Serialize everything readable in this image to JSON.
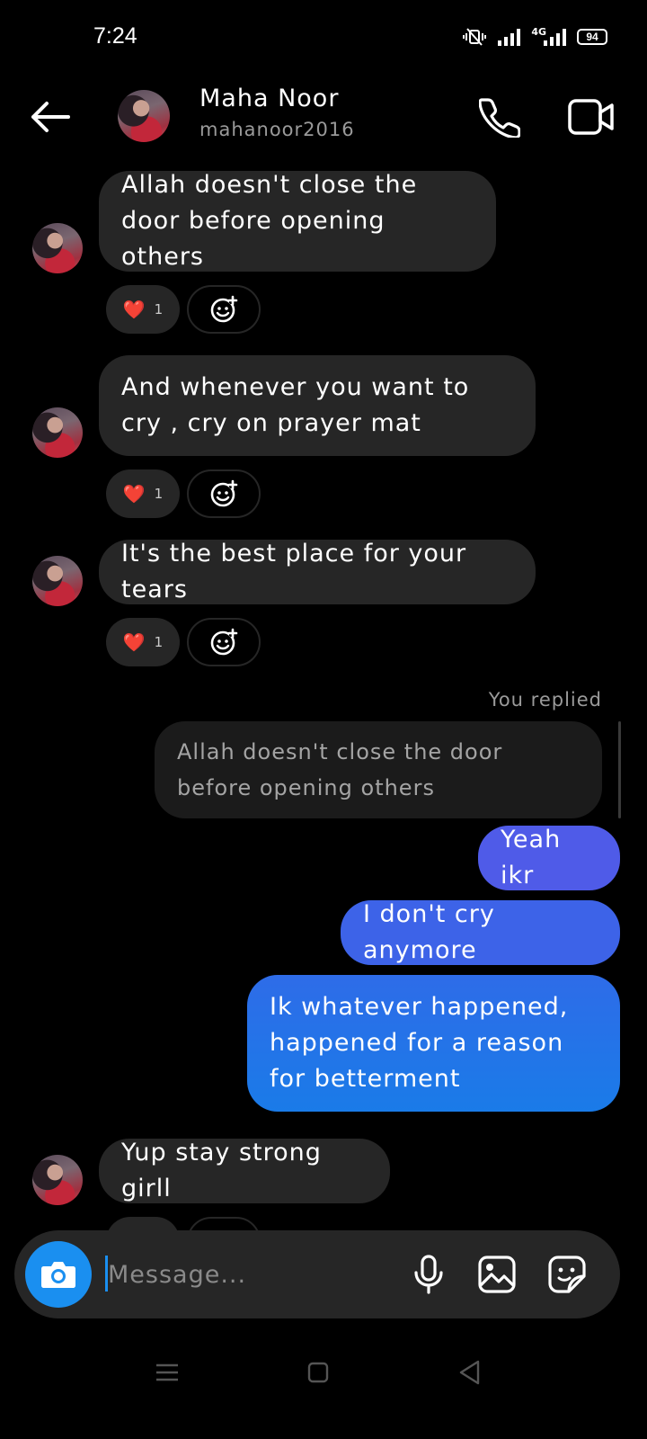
{
  "status_bar": {
    "time": "7:24",
    "network": "4G",
    "battery": "94",
    "icons": [
      "vibrate-icon",
      "signal-icon",
      "signal-4g-icon",
      "battery-icon"
    ]
  },
  "header": {
    "name": "Maha Noor",
    "username": "mahanoor2016",
    "icons": [
      "back-arrow-icon",
      "phone-icon",
      "video-icon"
    ]
  },
  "messages": [
    {
      "direction": "received",
      "text": "Allah doesn't close the door before opening others",
      "reaction": {
        "emoji": "❤️",
        "count": "1"
      }
    },
    {
      "direction": "received",
      "text": "And whenever you want to cry , cry on prayer mat",
      "reaction": {
        "emoji": "❤️",
        "count": "1"
      }
    },
    {
      "direction": "received",
      "text": "It's the best place for your tears",
      "reaction": {
        "emoji": "❤️",
        "count": "1"
      }
    },
    {
      "direction": "sent",
      "text": "Yeah ikr"
    },
    {
      "direction": "sent",
      "text": "I don't cry anymore"
    },
    {
      "direction": "sent",
      "text": "Ik whatever happened, happened for a reason for betterment"
    },
    {
      "direction": "received",
      "text": "Yup stay strong girll"
    }
  ],
  "reply": {
    "label": "You replied",
    "quoted_text": "Allah doesn't close the door before opening others"
  },
  "composer": {
    "placeholder": "Message...",
    "icons": [
      "camera-icon",
      "mic-icon",
      "gallery-icon",
      "sticker-icon"
    ]
  },
  "nav_bar": {
    "icons": [
      "menu-icon",
      "home-icon",
      "back-icon"
    ]
  },
  "colors": {
    "background": "#000000",
    "received_bubble": "#262626",
    "sent_bubble_top": "#4f5be8",
    "sent_bubble_bottom": "#1a7be8",
    "accent": "#1a8ff0"
  }
}
